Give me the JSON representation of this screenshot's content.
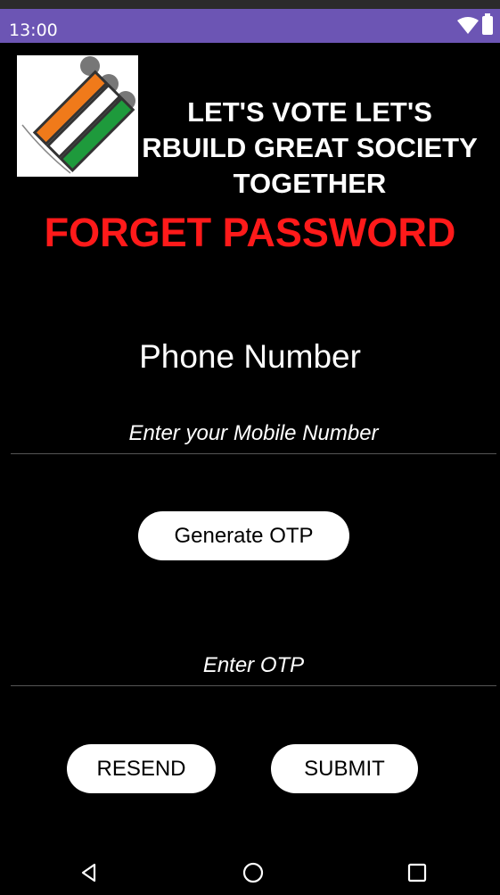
{
  "status_bar": {
    "time": "13:00",
    "icons": [
      "wifi-icon",
      "battery-icon"
    ],
    "color": "#6c55b4"
  },
  "header": {
    "logo_icon": "election-commission-logo",
    "tagline_line1": "LET'S VOTE LET'S",
    "tagline_line2": "RBUILD GREAT SOCIETY",
    "tagline_line3": "TOGETHER"
  },
  "title": {
    "text": "FORGET PASSWORD",
    "color": "#ff1a1a"
  },
  "phone_section": {
    "label": "Phone Number",
    "mobile_placeholder": "Enter your Mobile Number",
    "mobile_value": ""
  },
  "buttons": {
    "generate_otp": "Generate OTP",
    "resend": "RESEND",
    "submit": "SUBMIT"
  },
  "otp_section": {
    "placeholder": "Enter OTP",
    "value": ""
  },
  "nav_bar": {
    "icons": [
      "back-icon",
      "home-icon",
      "recents-icon"
    ]
  }
}
